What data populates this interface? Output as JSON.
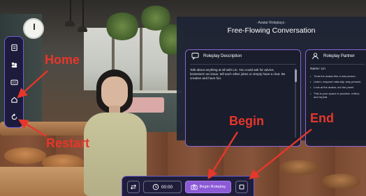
{
  "panel": {
    "subtitle": "· Avatar Roleplays ·",
    "title": "Free-Flowing Conversation",
    "description_card": {
      "title": "Roleplay Description",
      "icon": "chat-bubble-icon",
      "text": "Talk about anything at all with Lin. You could ask for advice, brainstorm an issue, tell each other jokes or simply have a chat. Be creative and have fun."
    },
    "partner_card": {
      "title": "Roleplay Partner",
      "icon": "person-icon",
      "name": "Name: Lin",
      "tips": [
        "Treat the avatar like a real person.",
        "Listen, respond naturally, stay present.",
        "Look at the avatar, not the panel.",
        "This is your space to practice, reflect, and repeat."
      ]
    }
  },
  "sidebar": {
    "items": [
      {
        "name": "sidebar-item-notes",
        "icon": "notes-icon"
      },
      {
        "name": "sidebar-item-scene",
        "icon": "scene-icon"
      },
      {
        "name": "sidebar-item-cc",
        "label": "CC",
        "icon": "captions-icon"
      },
      {
        "name": "sidebar-item-home",
        "icon": "home-icon"
      },
      {
        "name": "sidebar-item-restart",
        "icon": "restart-icon"
      }
    ]
  },
  "controls": {
    "timer": "00:00",
    "begin_label": "Begin Roleplay",
    "swap_icon": "swap-arrows-icon",
    "timer_icon": "clock-icon",
    "begin_icon": "camera-icon",
    "end_icon": "stop-square-icon"
  },
  "annotations": {
    "home": "Home",
    "restart": "Restart",
    "begin": "Begin",
    "end": "End"
  },
  "colors": {
    "accent_purple": "#8b5ad6",
    "panel_border": "#6d5fd1",
    "annotation_red": "#e8362b"
  }
}
